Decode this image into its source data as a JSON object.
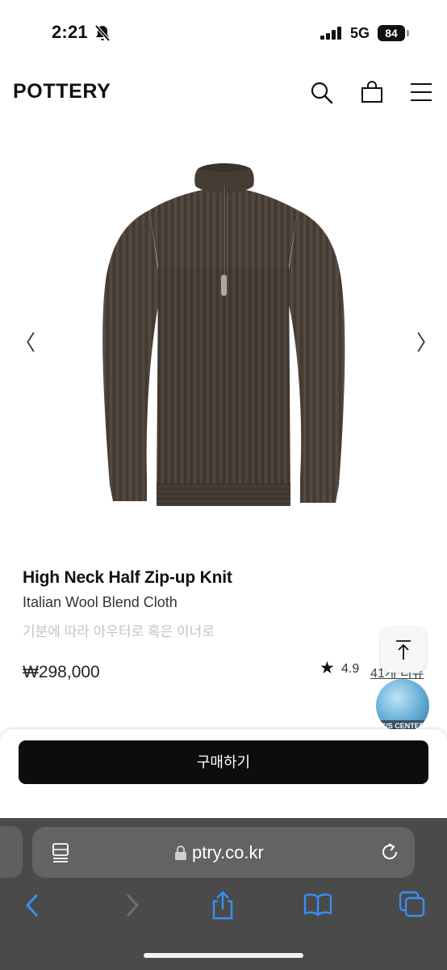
{
  "status_bar": {
    "time": "2:21",
    "network": "5G",
    "battery": "84"
  },
  "header": {
    "brand": "POTTERY"
  },
  "product": {
    "name": "High Neck Half Zip-up Knit",
    "subtitle": "Italian Wool Blend Cloth",
    "description": "기분에 따라 아우터로 혹은 이너로",
    "price": "₩298,000",
    "rating": "4.9",
    "reviews": "41개 리뷰",
    "prev_arrow": "〈",
    "next_arrow": "〉",
    "colors": {
      "sweater": "#4d433b"
    }
  },
  "cs_center": {
    "label": "C/S CENTER"
  },
  "purchase": {
    "buy_label": "구매하기"
  },
  "browser": {
    "url": "ptry.co.kr"
  },
  "icons": [
    "mute-icon",
    "signal-icon",
    "battery-icon",
    "search-icon",
    "cart-icon",
    "menu-icon",
    "star-icon",
    "arrow-up-icon",
    "reader-icon",
    "lock-icon",
    "reload-icon",
    "back-icon",
    "forward-icon",
    "share-icon",
    "bookmarks-icon",
    "tabs-icon"
  ]
}
